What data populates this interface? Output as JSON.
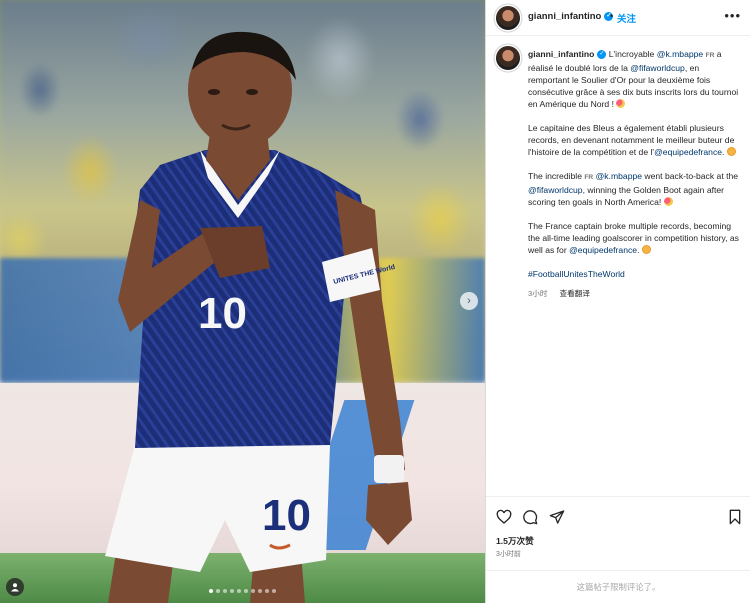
{
  "header": {
    "username": "gianni_infantino",
    "follow_label": "关注",
    "more_glyph": "•••"
  },
  "caption": {
    "username": "gianni_infantino",
    "fr_tag": "FR",
    "p1": {
      "t1": "L'incroyable ",
      "mention1": "@k.mbappe",
      "t2": " a réalisé le doublé lors de la ",
      "mention2": "@fifaworldcup",
      "t3": ", en remportant le Soulier d'Or pour la deuxième fois consécutive grâce à ses dix buts inscrits lors du tournoi en Amérique du Nord !"
    },
    "p2": {
      "t1": "Le capitaine des Bleus a également établi plusieurs records, en devenant notamment le meilleur buteur de l'histoire de la compétition et de l'",
      "mention": "@equipedefrance",
      "t2": "."
    },
    "p3": {
      "t1": "The incredible ",
      "mention1": "@k.mbappe",
      "t2": " went back-to-back at the ",
      "mention2": "@fifaworldcup",
      "t3": ", winning the Golden Boot again after scoring ten goals in North America!"
    },
    "p4": {
      "t1": "The France captain broke multiple records, becoming the all-time leading goalscorer in competition history, as well as for ",
      "mention": "@equipedefrance",
      "t2": "."
    },
    "hashtag": "#FootballUnitesTheWorld",
    "time": "3小时",
    "translate": "查看翻译"
  },
  "actions": {
    "icons": [
      "heart-icon",
      "comment-icon",
      "share-icon",
      "bookmark-icon"
    ]
  },
  "likes": "1.5万次赞",
  "post_time": "3小时前",
  "comments_disabled": "这篇帖子限制评论了。",
  "media": {
    "shirt_number": "10",
    "armband_text": "UNITES THE World",
    "carousel_count": 10,
    "carousel_active": 0
  },
  "colors": {
    "link": "#00376b",
    "follow": "#0095f6",
    "jersey": "#1c2f7a"
  }
}
